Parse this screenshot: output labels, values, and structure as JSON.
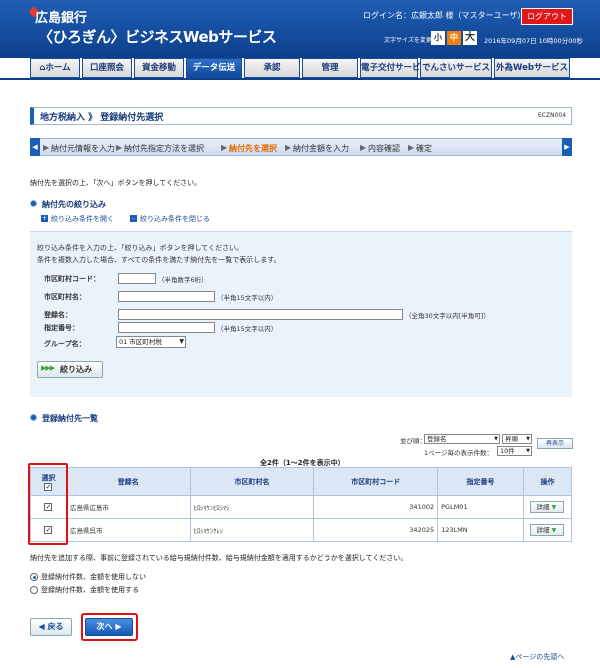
{
  "header": {
    "bank_name": "広島銀行",
    "service_name": "〈ひろぎん〉ビジネスWebサービス",
    "login_name": "ログイン名：広銀太郎 様（マスターユーザ）",
    "logout": "ログアウト",
    "fontsize_label": "文字サイズを変更",
    "fs_small": "小",
    "fs_mid": "中",
    "fs_large": "大",
    "datetime": "2016年09月07日 10時00分00秒"
  },
  "nav": {
    "home": "ホーム",
    "items": [
      "口座照会",
      "資金移動",
      "データ伝送",
      "承認",
      "管理",
      "電子交付サービス",
      "でんさいサービス",
      "外為Webサービス"
    ]
  },
  "title": {
    "text": "地方税納入 》 登録納付先選択",
    "screen_id": "ECZN004"
  },
  "steps": {
    "items": [
      "納付元情報を入力",
      "納付先指定方法を選択",
      "納付先を選択",
      "納付金額を入力",
      "内容確認",
      "確定"
    ]
  },
  "instruction": "納付先を選択の上、「次へ」ボタンを押してください。",
  "filter": {
    "heading": "納付先の絞り込み",
    "open_label": "絞り込み条件を開く",
    "close_label": "絞り込み条件を閉じる",
    "help1": "絞り込み条件を入力の上、「絞り込み」ボタンを押してください。",
    "help2": "条件を複数入力した場合、すべての条件を満たす納付先を一覧で表示します。",
    "code_label": "市区町村コード：",
    "code_hint": "（半角数字6桁）",
    "city_label": "市区町村名：",
    "city_hint": "（半角15文字以内）",
    "reg_label": "登録名：",
    "reg_hint": "（全角30文字以内[半角可]）",
    "designation_label": "指定番号：",
    "designation_hint": "（半角15文字以内）",
    "group_label": "グループ名：",
    "group_value": "01 市区町村税",
    "button": "絞り込み"
  },
  "list": {
    "heading": "登録納付先一覧",
    "sort_label": "並び順：",
    "sort_value": "登録名",
    "order_value": "昇順",
    "perpage_label": "1ページ毎の表示件数：",
    "perpage_value": "10件",
    "redisplay": "再表示",
    "count_caption": "全2件（1～2件を表示中）",
    "columns": [
      "選択",
      "登録名",
      "市区町村名",
      "市区町村コード",
      "指定番号",
      "操作"
    ],
    "rows": [
      {
        "name": "広島県広島市",
        "city": "ﾋﾛｼﾏｹﾝﾋﾛｼﾏｼ",
        "code": "341002",
        "number": "PGLM01",
        "action": "詳細"
      },
      {
        "name": "広島県呉市",
        "city": "ﾋﾛｼﾏｹﾝｸﾚｼ",
        "code": "342025",
        "number": "123LMN",
        "action": "詳細"
      }
    ]
  },
  "note": "納付先を追加する際、事前に登録されている給与規納付件数、給与規納付金額を適用するかどうかを選択してください。",
  "radios": [
    "登録納付件数、金額を使用しない",
    "登録納付件数、金額を使用する"
  ],
  "footer": {
    "back": "戻る",
    "next": "次へ",
    "page_top": "ページの先頭へ"
  },
  "colors": {
    "primary": "#1a5fb5",
    "highlight_red": "#e01010",
    "current_step": "#e66a00"
  }
}
